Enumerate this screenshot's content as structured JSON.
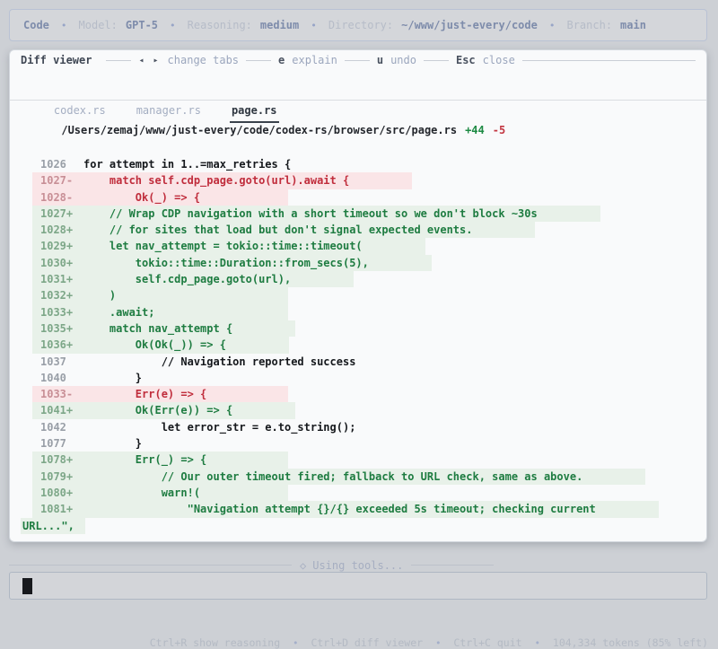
{
  "colors": {
    "page_background": "#cdd0d5",
    "panel_background": "#f9fafb",
    "addition_text": "#1e7c41",
    "addition_background": "#e8f1e9",
    "deletion_text": "#c02d3c",
    "deletion_background": "#fae5e7",
    "accent_blue": "#7e8cab"
  },
  "topbar": {
    "app": "Code",
    "bullet": "•",
    "items": [
      {
        "label": "Model:",
        "value": "GPT-5"
      },
      {
        "label": "Reasoning:",
        "value": "medium"
      },
      {
        "label": "Directory:",
        "value": "~/www/just-every/code"
      },
      {
        "label": "Branch:",
        "value": "main"
      }
    ]
  },
  "diff_viewer": {
    "title": "Diff viewer",
    "hints": [
      {
        "key": "◂ ▸",
        "label": "change tabs"
      },
      {
        "key": "e",
        "label": "explain"
      },
      {
        "key": "u",
        "label": "undo"
      },
      {
        "key": "Esc",
        "label": "close"
      }
    ],
    "tabs": [
      {
        "label": "codex.rs",
        "active": false
      },
      {
        "label": "manager.rs",
        "active": false
      },
      {
        "label": "page.rs",
        "active": true
      }
    ],
    "file": {
      "path": "/Users/zemaj/www/just-every/code/codex-rs/browser/src/page.rs",
      "additions": "+44",
      "deletions": "-5"
    },
    "lines": [
      {
        "num": "1026",
        "sign": "",
        "type": "ctx",
        "code": "for attempt in 1..=max_retries {"
      },
      {
        "num": "1027",
        "sign": "-",
        "type": "del",
        "code": "    match self.cdp_page.goto(url).await {"
      },
      {
        "num": "1028",
        "sign": "-",
        "type": "del",
        "code": "        Ok(_) => {"
      },
      {
        "num": "1027",
        "sign": "+",
        "type": "add",
        "code": "    // Wrap CDP navigation with a short timeout so we don't block ~30s"
      },
      {
        "num": "1028",
        "sign": "+",
        "type": "add",
        "code": "    // for sites that load but don't signal expected events."
      },
      {
        "num": "1029",
        "sign": "+",
        "type": "add",
        "code": "    let nav_attempt = tokio::time::timeout("
      },
      {
        "num": "1030",
        "sign": "+",
        "type": "add",
        "code": "        tokio::time::Duration::from_secs(5),"
      },
      {
        "num": "1031",
        "sign": "+",
        "type": "add",
        "code": "        self.cdp_page.goto(url),"
      },
      {
        "num": "1032",
        "sign": "+",
        "type": "add",
        "code": "    )"
      },
      {
        "num": "1033",
        "sign": "+",
        "type": "add",
        "code": "    .await;"
      },
      {
        "num": "1035",
        "sign": "+",
        "type": "add",
        "code": "    match nav_attempt {"
      },
      {
        "num": "1036",
        "sign": "+",
        "type": "add",
        "code": "        Ok(Ok(_)) => {"
      },
      {
        "num": "1037",
        "sign": "",
        "type": "ctx",
        "code": "            // Navigation reported success"
      },
      {
        "num": "1040",
        "sign": "",
        "type": "ctx",
        "code": "        }"
      },
      {
        "num": "1033",
        "sign": "-",
        "type": "del",
        "code": "        Err(e) => {"
      },
      {
        "num": "1041",
        "sign": "+",
        "type": "add",
        "code": "        Ok(Err(e)) => {"
      },
      {
        "num": "1042",
        "sign": "",
        "type": "ctx",
        "code": "            let error_str = e.to_string();"
      },
      {
        "num": "1077",
        "sign": "",
        "type": "ctx",
        "code": "        }"
      },
      {
        "num": "1078",
        "sign": "+",
        "type": "add",
        "code": "        Err(_) => {"
      },
      {
        "num": "1079",
        "sign": "+",
        "type": "add",
        "code": "            // Our outer timeout fired; fallback to URL check, same as above."
      },
      {
        "num": "1080",
        "sign": "+",
        "type": "add",
        "code": "            warn!("
      },
      {
        "num": "1081",
        "sign": "+",
        "type": "add",
        "code": "                \"Navigation attempt {}/{} exceeded 5s timeout; checking current"
      },
      {
        "num": "",
        "sign": "",
        "type": "add",
        "wrap": true,
        "code": "URL...\","
      }
    ]
  },
  "status": {
    "icon": "◇",
    "label": "Using tools..."
  },
  "composer": {
    "value": ""
  },
  "footer": {
    "bullet": "•",
    "items": [
      "Ctrl+R show reasoning",
      "Ctrl+D diff viewer",
      "Ctrl+C quit",
      "104,334 tokens (85% left)"
    ]
  }
}
